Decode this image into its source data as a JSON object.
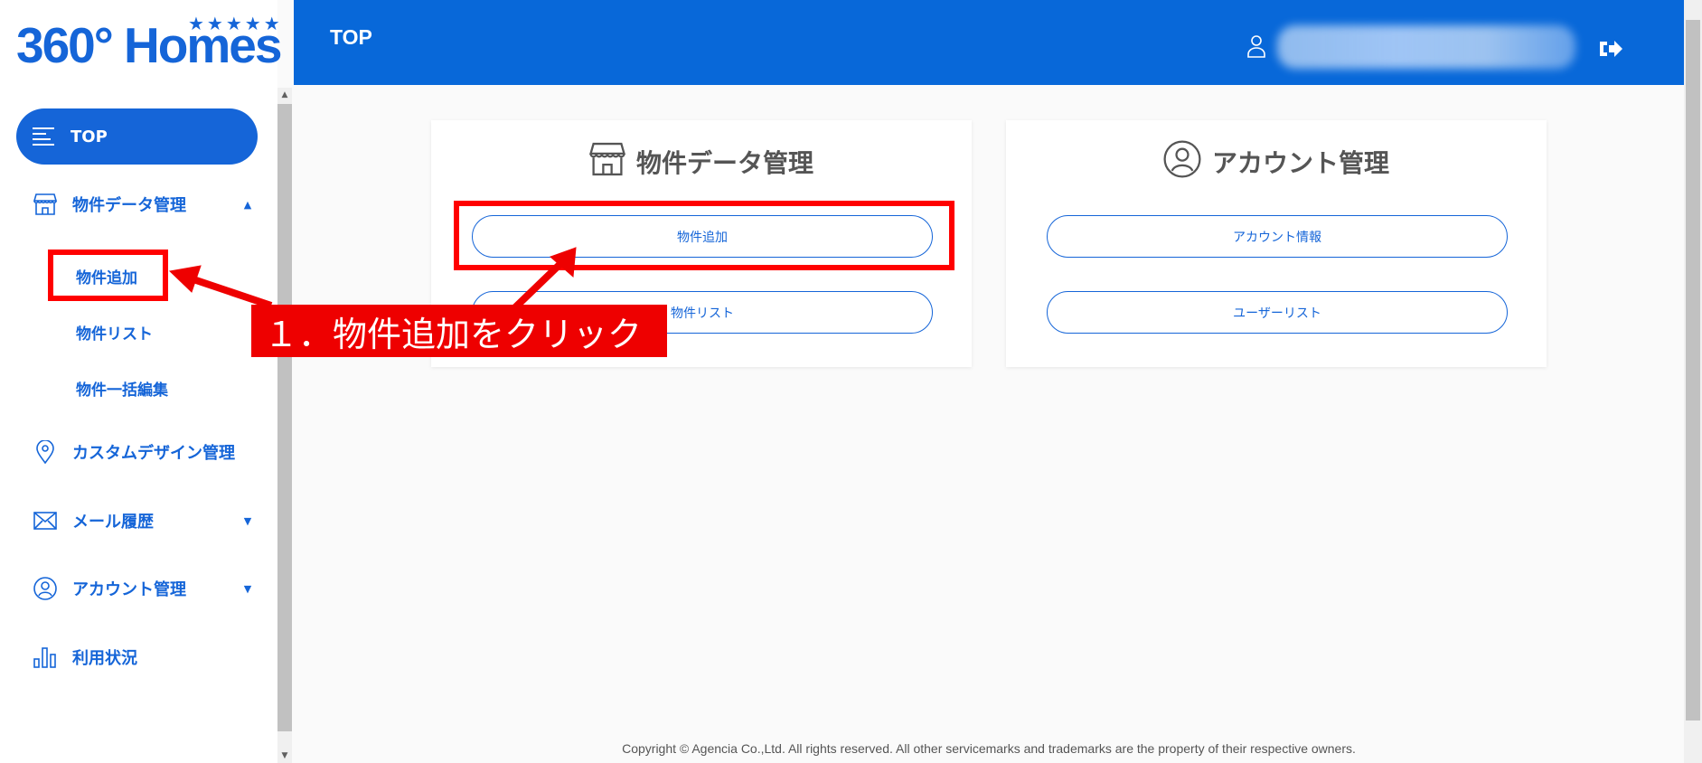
{
  "brand": {
    "name": "360° Homes",
    "stars": "★★★★★",
    "color": "#1565d8"
  },
  "header": {
    "title": "TOP",
    "user_icon": "user-icon",
    "logout_icon": "logout-icon",
    "bg": "#0868d9"
  },
  "sidebar": {
    "top": {
      "label": "TOP",
      "icon": "menu-lines-icon"
    },
    "property": {
      "label": "物件データ管理",
      "icon": "storefront-icon",
      "children": [
        "物件追加",
        "物件リスト",
        "物件一括編集"
      ]
    },
    "design": {
      "label": "カスタムデザイン管理",
      "icon": "map-pin-icon"
    },
    "mail": {
      "label": "メール履歴",
      "icon": "envelope-icon"
    },
    "account": {
      "label": "アカウント管理",
      "icon": "user-circle-icon"
    },
    "usage": {
      "label": "利用状況",
      "icon": "bar-chart-icon"
    }
  },
  "cards": [
    {
      "title": "物件データ管理",
      "icon": "storefront-icon",
      "buttons": [
        "物件追加",
        "物件リスト"
      ]
    },
    {
      "title": "アカウント管理",
      "icon": "user-circle-icon",
      "buttons": [
        "アカウント情報",
        "ユーザーリスト"
      ]
    }
  ],
  "annotation": {
    "callout": "１．物件追加をクリック",
    "color": "#ee0000"
  },
  "footer": "Copyright © Agencia Co.,Ltd. All rights reserved. All other servicemarks and trademarks are the property of their respective owners."
}
